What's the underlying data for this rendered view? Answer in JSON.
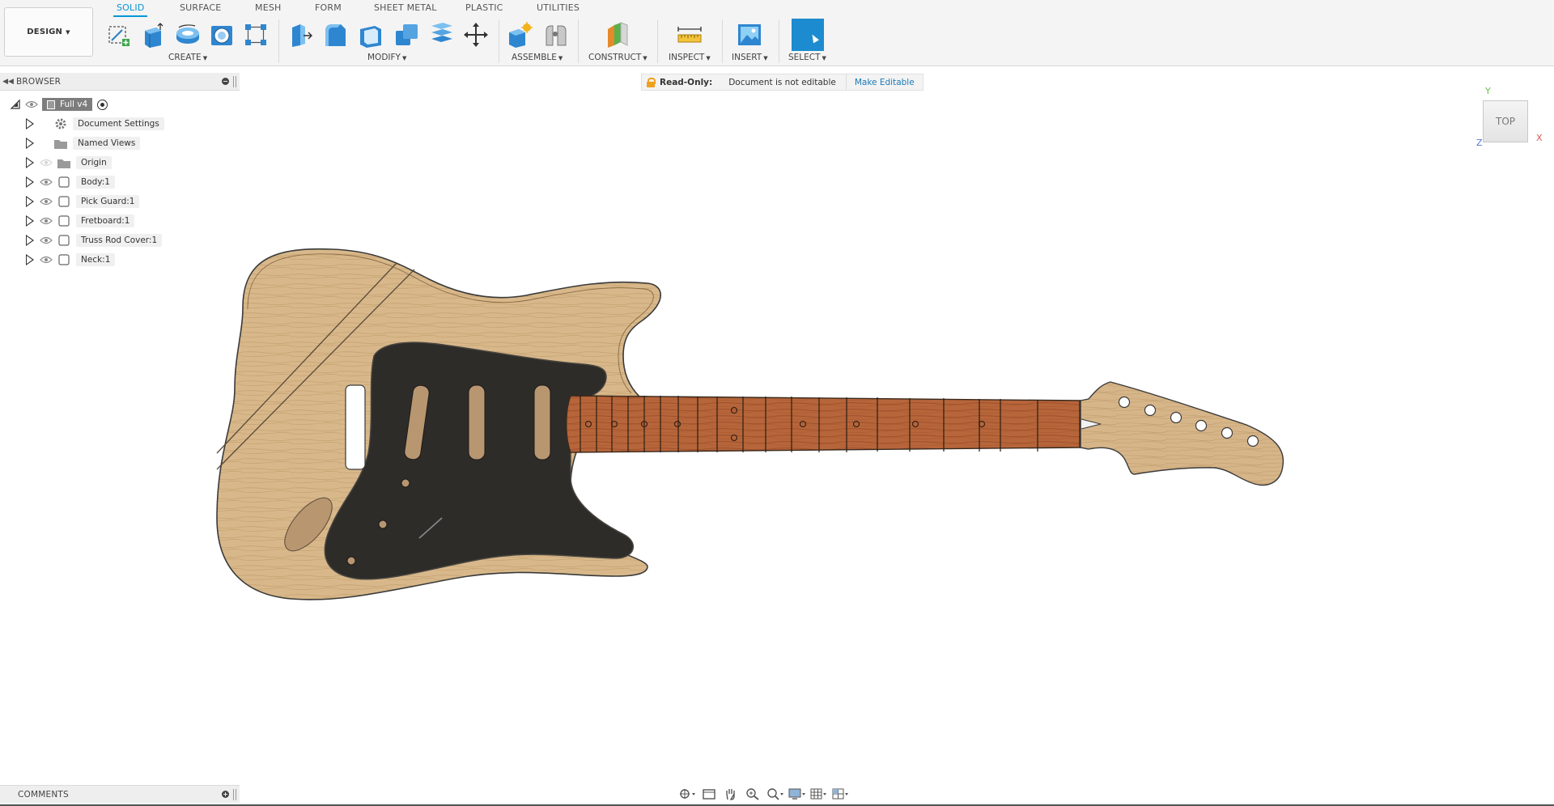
{
  "toolbar": {
    "workspace_label": "DESIGN",
    "tabs": [
      "SOLID",
      "SURFACE",
      "MESH",
      "FORM",
      "SHEET METAL",
      "PLASTIC",
      "UTILITIES"
    ],
    "active_tab": "SOLID",
    "groups": {
      "create": "CREATE",
      "modify": "MODIFY",
      "assemble": "ASSEMBLE",
      "construct": "CONSTRUCT",
      "inspect": "INSPECT",
      "insert": "INSERT",
      "select": "SELECT"
    },
    "accent_color": "#0696d7"
  },
  "browser": {
    "title": "BROWSER",
    "root": "Full v4",
    "items": [
      {
        "label": "Document Settings",
        "icon": "gear-icon"
      },
      {
        "label": "Named Views",
        "icon": "folder-icon"
      },
      {
        "label": "Origin",
        "icon": "folder-icon"
      },
      {
        "label": "Body:1",
        "icon": "component-icon"
      },
      {
        "label": "Pick Guard:1",
        "icon": "component-icon"
      },
      {
        "label": "Fretboard:1",
        "icon": "component-icon"
      },
      {
        "label": "Truss Rod Cover:1",
        "icon": "component-icon"
      },
      {
        "label": "Neck:1",
        "icon": "component-icon"
      }
    ]
  },
  "readonly_bar": {
    "title": "Read-Only:",
    "message": "Document is not editable",
    "action": "Make Editable"
  },
  "viewcube": {
    "face": "TOP",
    "axis_y": "Y",
    "axis_x": "X",
    "axis_z": "Z"
  },
  "comments": {
    "title": "COMMENTS"
  }
}
